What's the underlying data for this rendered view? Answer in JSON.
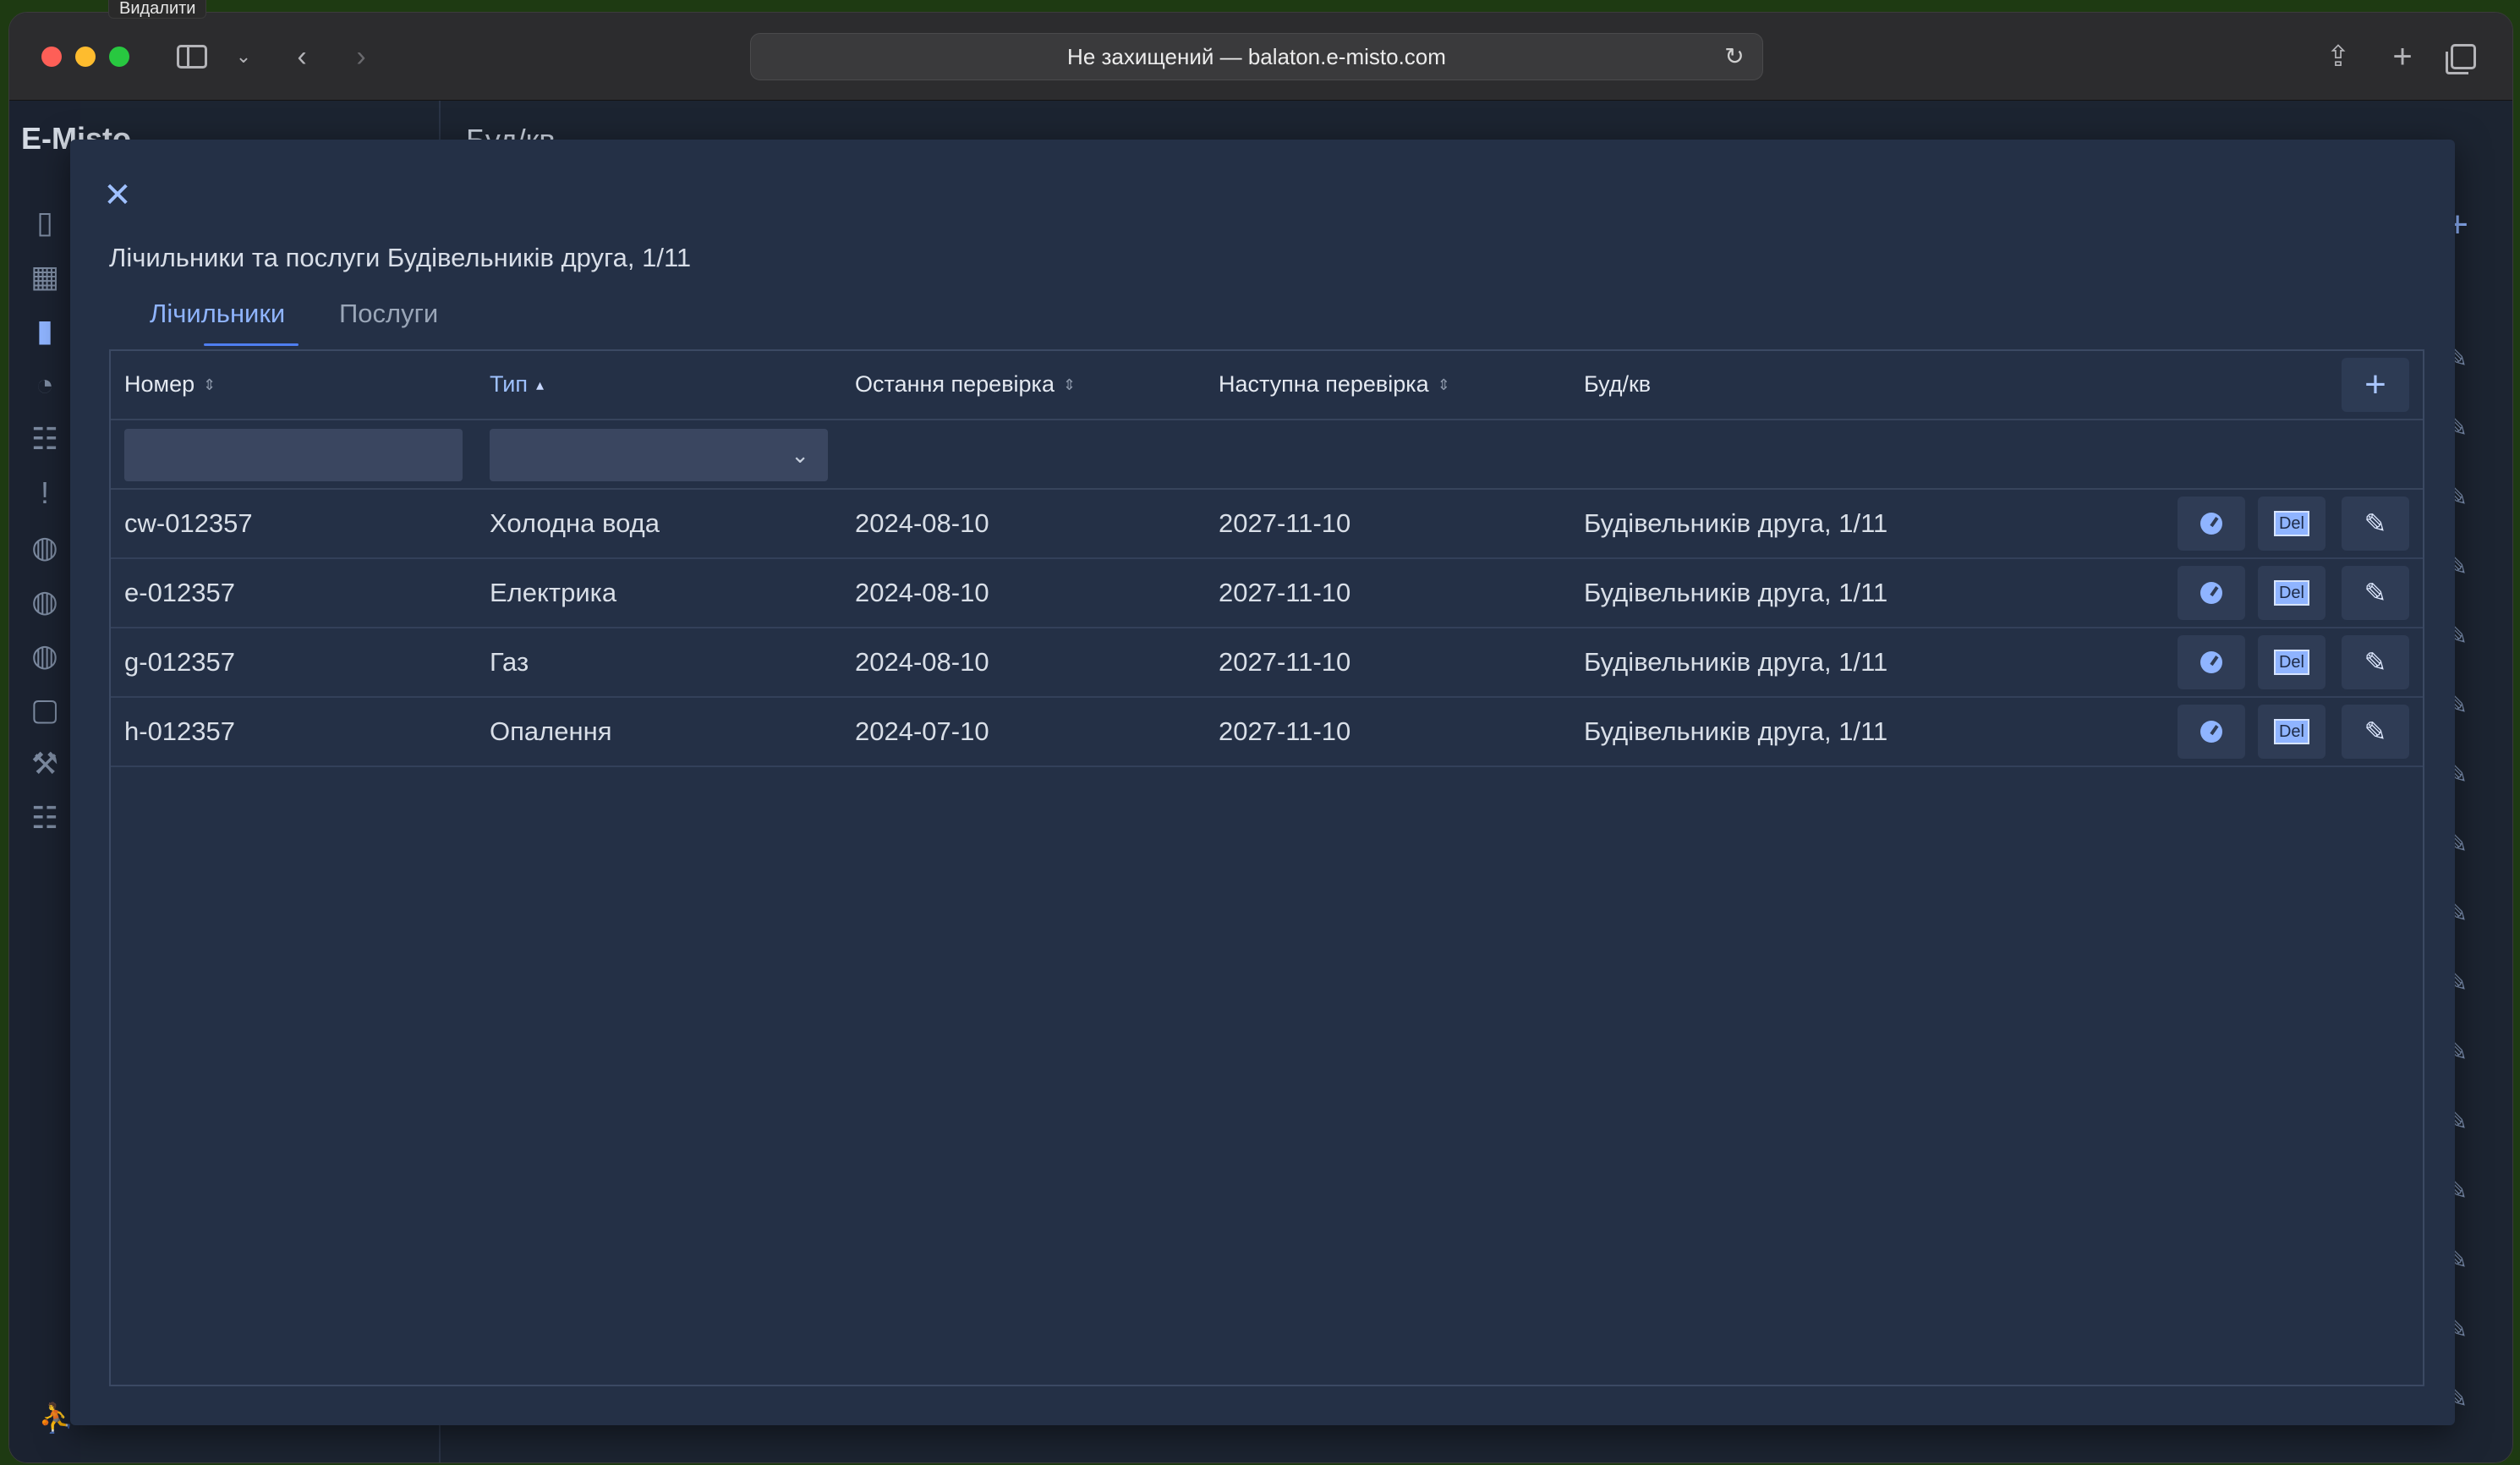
{
  "tooltip": "Видалити",
  "browser": {
    "address": "Не захищений — balaton.e-misto.com"
  },
  "app": {
    "logo": "E-Misto",
    "header": "Буд/кв",
    "add_symbol": "+",
    "edit_symbol": "✎"
  },
  "modal": {
    "close_symbol": "✕",
    "title": "Лічильники та послуги Будівельників друга, 1/11",
    "tabs": [
      {
        "label": "Лічильники"
      },
      {
        "label": "Послуги"
      }
    ],
    "columns": {
      "number": "Номер",
      "type": "Тип",
      "last_check": "Остання перевірка",
      "next_check": "Наступна перевірка",
      "address": "Буд/кв"
    },
    "add_symbol": "+",
    "filter_number_value": "",
    "filter_type_value": "",
    "rows": [
      {
        "number": "cw-012357",
        "type": "Холодна вода",
        "last_check": "2024-08-10",
        "next_check": "2027-11-10",
        "address": "Будівельників друга, 1/11"
      },
      {
        "number": "e-012357",
        "type": "Електрика",
        "last_check": "2024-08-10",
        "next_check": "2027-11-10",
        "address": "Будівельників друга, 1/11"
      },
      {
        "number": "g-012357",
        "type": "Газ",
        "last_check": "2024-08-10",
        "next_check": "2027-11-10",
        "address": "Будівельників друга, 1/11"
      },
      {
        "number": "h-012357",
        "type": "Опалення",
        "last_check": "2024-07-10",
        "next_check": "2027-11-10",
        "address": "Будівельників друга, 1/11"
      }
    ],
    "row_actions": {
      "del_label": "Del",
      "edit_symbol": "✎"
    }
  },
  "colors": {
    "accent": "#8fb4ff",
    "modal_bg": "#243046",
    "app_bg": "#1c2431"
  }
}
